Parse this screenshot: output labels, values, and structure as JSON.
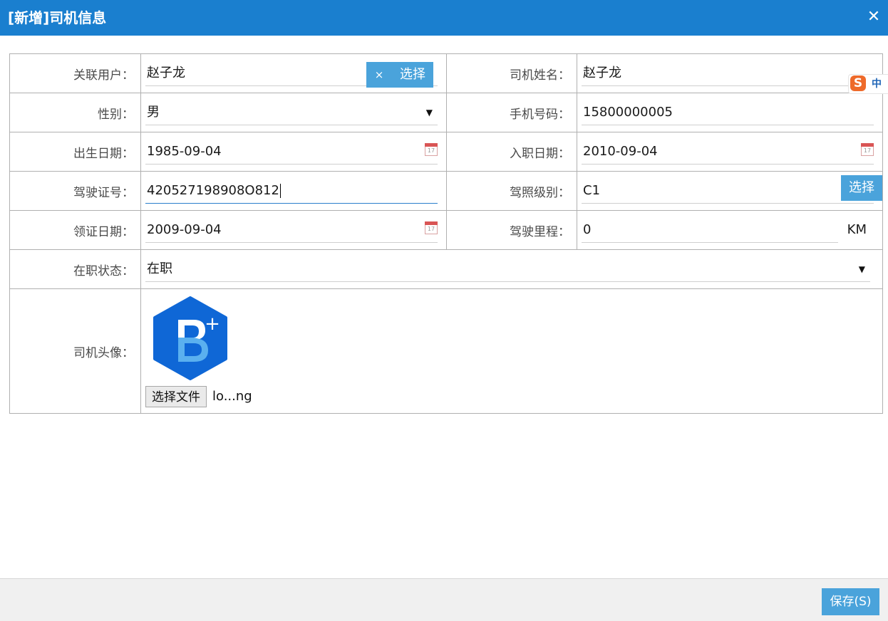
{
  "dialog": {
    "title": "[新增]司机信息",
    "close_label": "✕"
  },
  "form": {
    "linked_user": {
      "label": "关联用户：",
      "value": "赵子龙",
      "clear_label": "×",
      "select_label": "选择"
    },
    "driver_name": {
      "label": "司机姓名：",
      "value": "赵子龙"
    },
    "gender": {
      "label": "性别：",
      "value": "男",
      "arrow": "▼"
    },
    "phone": {
      "label": "手机号码：",
      "value": "15800000005"
    },
    "birth_date": {
      "label": "出生日期：",
      "value": "1985-09-04",
      "cal_day": "17"
    },
    "hire_date": {
      "label": "入职日期：",
      "value": "2010-09-04",
      "cal_day": "17"
    },
    "license_no": {
      "label": "驾驶证号：",
      "value": "420527198908O812"
    },
    "license_class": {
      "label": "驾照级别：",
      "value": "C1",
      "select_label": "选择"
    },
    "issue_date": {
      "label": "领证日期：",
      "value": "2009-09-04",
      "cal_day": "17"
    },
    "mileage": {
      "label": "驾驶里程：",
      "value": "0",
      "unit": "KM"
    },
    "status": {
      "label": "在职状态：",
      "value": "在职",
      "arrow": "▼"
    },
    "avatar": {
      "label": "司机头像：",
      "file_button": "选择文件",
      "file_name": "lo...ng",
      "logo_text": "B+"
    }
  },
  "ime": {
    "logo": "S",
    "mode": "中"
  },
  "footer": {
    "save_label": "保存(S)"
  },
  "colors": {
    "titlebar": "#1a7fcf",
    "button": "#4aa3db",
    "logo_blue": "#0f67d6",
    "logo_light": "#5ab0ef"
  }
}
